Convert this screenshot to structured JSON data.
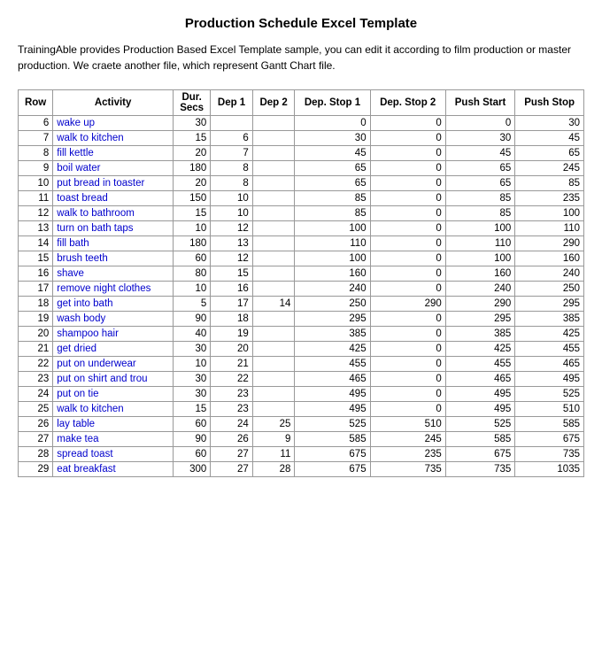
{
  "title": "Production Schedule Excel Template",
  "description": "TrainingAble provides Production Based Excel Template sample, you can edit it according to film production or master production. We craete another file, which represent Gantt Chart file.",
  "table": {
    "headers": [
      "Row",
      "Activity",
      "Dur. Secs",
      "Dep 1",
      "Dep 2",
      "Dep. Stop 1",
      "Dep. Stop 2",
      "Push Start",
      "Push Stop"
    ],
    "rows": [
      [
        6,
        "wake up",
        30,
        "",
        "",
        0,
        0,
        0,
        30
      ],
      [
        7,
        "walk to kitchen",
        15,
        6,
        "",
        30,
        0,
        30,
        45
      ],
      [
        8,
        "fill kettle",
        20,
        7,
        "",
        45,
        0,
        45,
        65
      ],
      [
        9,
        "boil water",
        180,
        8,
        "",
        65,
        0,
        65,
        245
      ],
      [
        10,
        "put bread in toaster",
        20,
        8,
        "",
        65,
        0,
        65,
        85
      ],
      [
        11,
        "toast bread",
        150,
        10,
        "",
        85,
        0,
        85,
        235
      ],
      [
        12,
        "walk to bathroom",
        15,
        10,
        "",
        85,
        0,
        85,
        100
      ],
      [
        13,
        "turn on bath taps",
        10,
        12,
        "",
        100,
        0,
        100,
        110
      ],
      [
        14,
        "fill bath",
        180,
        13,
        "",
        110,
        0,
        110,
        290
      ],
      [
        15,
        "brush teeth",
        60,
        12,
        "",
        100,
        0,
        100,
        160
      ],
      [
        16,
        "shave",
        80,
        15,
        "",
        160,
        0,
        160,
        240
      ],
      [
        17,
        "remove night clothes",
        10,
        16,
        "",
        240,
        0,
        240,
        250
      ],
      [
        18,
        "get into bath",
        5,
        17,
        14,
        250,
        290,
        290,
        295
      ],
      [
        19,
        "wash body",
        90,
        18,
        "",
        295,
        0,
        295,
        385
      ],
      [
        20,
        "shampoo hair",
        40,
        19,
        "",
        385,
        0,
        385,
        425
      ],
      [
        21,
        "get dried",
        30,
        20,
        "",
        425,
        0,
        425,
        455
      ],
      [
        22,
        "put on underwear",
        10,
        21,
        "",
        455,
        0,
        455,
        465
      ],
      [
        23,
        "put on shirt and trou",
        30,
        22,
        "",
        465,
        0,
        465,
        495
      ],
      [
        24,
        "put on tie",
        30,
        23,
        "",
        495,
        0,
        495,
        525
      ],
      [
        25,
        "walk to kitchen",
        15,
        23,
        "",
        495,
        0,
        495,
        510
      ],
      [
        26,
        "lay table",
        60,
        24,
        25,
        525,
        510,
        525,
        585
      ],
      [
        27,
        "make tea",
        90,
        26,
        9,
        585,
        245,
        585,
        675
      ],
      [
        28,
        "spread toast",
        60,
        27,
        11,
        675,
        235,
        675,
        735
      ],
      [
        29,
        "eat breakfast",
        300,
        27,
        28,
        675,
        735,
        735,
        1035
      ]
    ]
  }
}
